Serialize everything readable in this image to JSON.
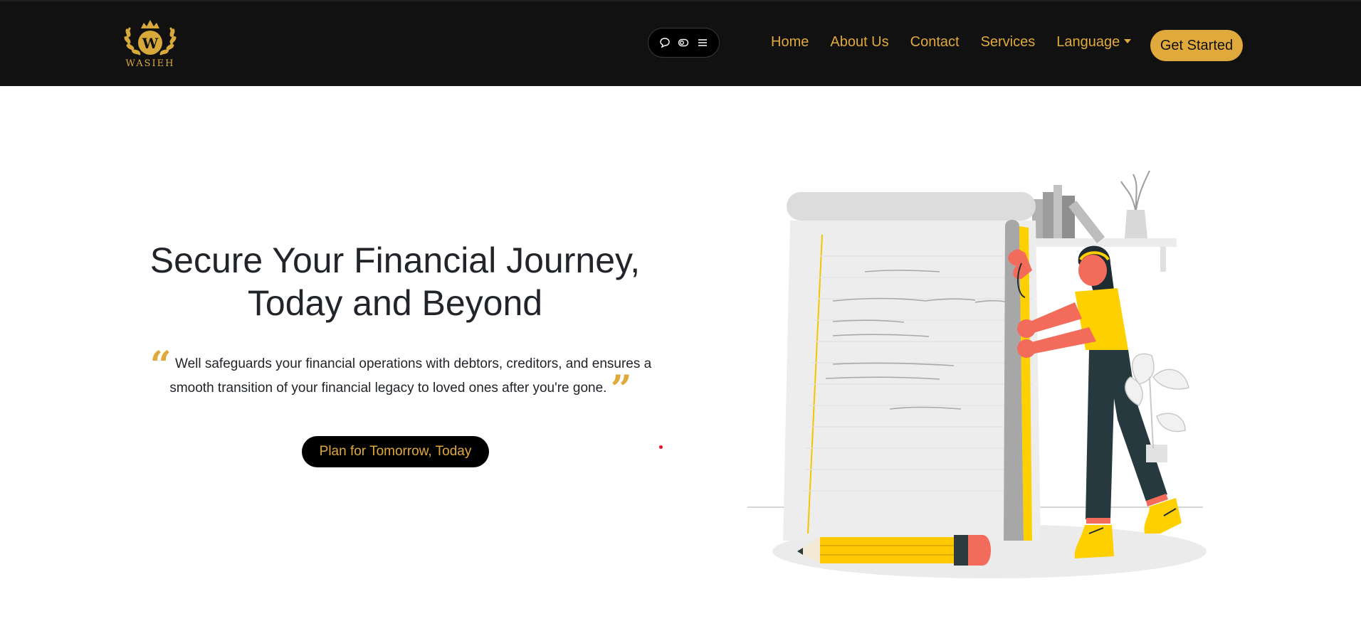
{
  "brand": {
    "name": "WASIEH",
    "accent": "#e0a93b",
    "nav_bg": "#111111"
  },
  "toolbar": {
    "icons": [
      "speech-bubble-icon",
      "accessibility-toggle-icon",
      "menu-icon"
    ]
  },
  "nav": {
    "items": [
      {
        "label": "Home"
      },
      {
        "label": "About Us"
      },
      {
        "label": "Contact"
      },
      {
        "label": "Services"
      },
      {
        "label": "Language"
      }
    ],
    "cta_label": "Get Started"
  },
  "hero": {
    "title_line1": "Secure Your Financial Journey,",
    "title_line2": "Today and Beyond",
    "quote": "Well safeguards your financial operations with debtors, creditors, and ensures a smooth transition of your financial legacy to loved ones after you're gone.",
    "button_label": "Plan for Tomorrow, Today"
  }
}
